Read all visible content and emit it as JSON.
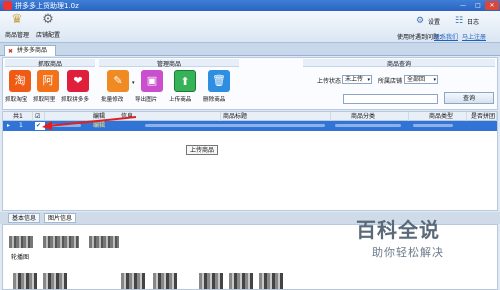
{
  "window": {
    "title": "拼多多上货助理1.0z",
    "controls": [
      "—",
      "□",
      "✕"
    ]
  },
  "toolbar": {
    "product_mgmt": "商品管理",
    "store_config": "店铺配置",
    "settings": "设置",
    "log": "日志",
    "usage_help": "使用时遇到问题：",
    "contact_us": "联系我们",
    "register_now": "马上注册"
  },
  "tabs": {
    "main": "拼多多商品"
  },
  "groups": {
    "fetch": "抓取商品",
    "manage": "管理商品",
    "query": "商品查询"
  },
  "actions": {
    "fetch_taobao": "抓取淘宝",
    "fetch_1688": "抓取阿里",
    "fetch_pdd": "抓取拼多多",
    "batch_edit": "批量修改",
    "export_images": "导出图片",
    "upload_product": "上传商品",
    "delete_product": "删除商品"
  },
  "query": {
    "upload_status_label": "上传状态",
    "upload_status_value": "未上传",
    "store_label": "所属店铺",
    "store_value": "全部回",
    "search_value": "",
    "query_button": "查询"
  },
  "grid": {
    "columns": [
      "共1",
      "编辑",
      "信息",
      "商品标题",
      "商品分类",
      "商品类型",
      "是否拼团"
    ],
    "row": {
      "index": "1",
      "checked": true,
      "edit": "编辑"
    }
  },
  "tooltip": "上传商品",
  "bottom_tabs": [
    "基本信息",
    "图片信息"
  ],
  "carousel_label": "轮播图",
  "watermark": {
    "logo": "百科全说",
    "sub": "助你轻松解决"
  },
  "colors": {
    "title_bar": "#2a63c0",
    "selected_row": "#3274d6",
    "taobao": "#ef5b14",
    "alibaba": "#f1721b",
    "pdd": "#e0203a",
    "batch": "#f08a22",
    "export": "#c94fcf",
    "upload": "#35b356",
    "delete": "#2e8fe0"
  }
}
